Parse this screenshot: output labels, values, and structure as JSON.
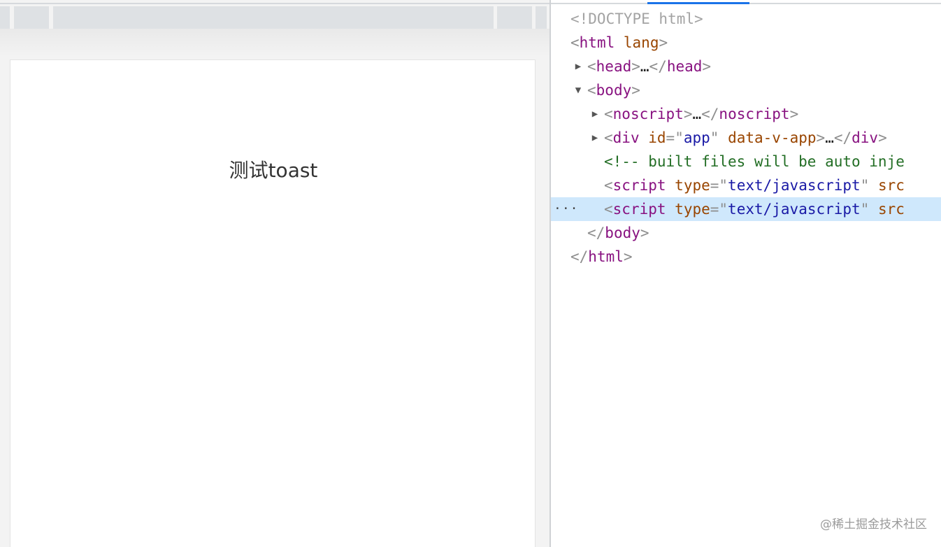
{
  "preview": {
    "page_text": "测试toast"
  },
  "devtools": {
    "lines": {
      "doctype": "<!DOCTYPE html>",
      "html_open": {
        "lt": "<",
        "tag": "html",
        "attr": "lang",
        "gt": ">"
      },
      "head": {
        "lt": "<",
        "tag": "head",
        "gt": ">",
        "dots": "…",
        "close_lt": "</",
        "close_tag": "head",
        "close_gt": ">"
      },
      "body_open": {
        "lt": "<",
        "tag": "body",
        "gt": ">"
      },
      "noscript": {
        "lt": "<",
        "tag": "noscript",
        "gt": ">",
        "dots": "…",
        "close_lt": "</",
        "close_tag": "noscript",
        "close_gt": ">"
      },
      "div_app": {
        "lt": "<",
        "tag": "div",
        "attr1": "id",
        "eq": "=\"",
        "val1": "app",
        "q": "\"",
        "attr2": "data-v-app",
        "gt": ">",
        "dots": "…",
        "close_lt": "</",
        "close_tag": "div",
        "close_gt": ">"
      },
      "comment": "<!-- built files will be auto inje",
      "script1": {
        "lt": "<",
        "tag": "script",
        "attr": "type",
        "eq": "=\"",
        "val": "text/javascript",
        "q": "\"",
        "attr2": "src"
      },
      "script2": {
        "lt": "<",
        "tag": "script",
        "attr": "type",
        "eq": "=\"",
        "val": "text/javascript",
        "q": "\"",
        "attr2": "src"
      },
      "body_close": {
        "lt": "</",
        "tag": "body",
        "gt": ">"
      },
      "html_close": {
        "lt": "</",
        "tag": "html",
        "gt": ">"
      }
    },
    "selected_menu": "···",
    "collapsed_icon": "▶",
    "expanded_icon": "▼"
  },
  "watermark": "@稀土掘金技术社区",
  "colors": {
    "tag": "#881280",
    "attribute": "#994500",
    "value": "#1a1aa6",
    "comment": "#236e25",
    "selection": "#cfe8fc"
  }
}
